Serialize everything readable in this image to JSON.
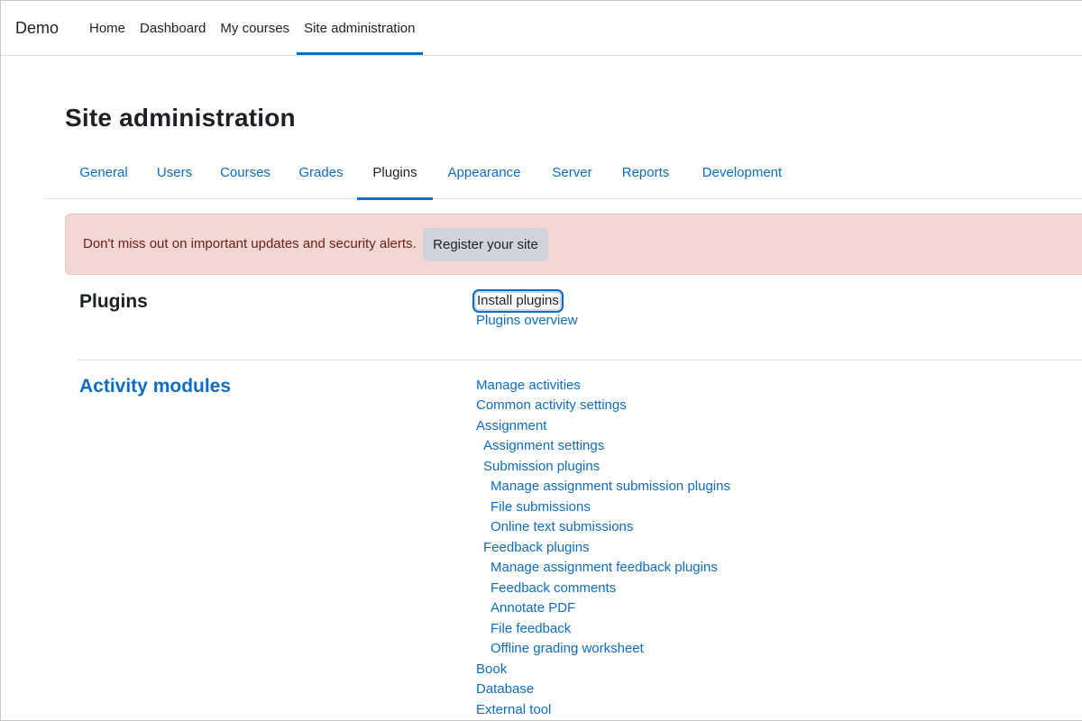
{
  "navbar": {
    "brand": "Demo",
    "items": [
      {
        "label": "Home"
      },
      {
        "label": "Dashboard"
      },
      {
        "label": "My courses"
      },
      {
        "label": "Site administration"
      }
    ]
  },
  "page": {
    "title": "Site administration"
  },
  "tabs": [
    {
      "label": "General"
    },
    {
      "label": "Users"
    },
    {
      "label": "Courses"
    },
    {
      "label": "Grades"
    },
    {
      "label": "Plugins"
    },
    {
      "label": "Appearance"
    },
    {
      "label": "Server"
    },
    {
      "label": "Reports"
    },
    {
      "label": "Development"
    }
  ],
  "alert": {
    "text": "Don't miss out on important updates and security alerts.",
    "button": "Register your site"
  },
  "plugins_section": {
    "title": "Plugins",
    "links": [
      "Install plugins",
      "Plugins overview"
    ]
  },
  "activity_section": {
    "title": "Activity modules",
    "links": [
      {
        "label": "Manage activities"
      },
      {
        "label": "Common activity settings"
      },
      {
        "label": "Assignment"
      },
      {
        "label": "Assignment settings"
      },
      {
        "label": "Submission plugins"
      },
      {
        "label": "Manage assignment submission plugins"
      },
      {
        "label": "File submissions"
      },
      {
        "label": "Online text submissions"
      },
      {
        "label": "Feedback plugins"
      },
      {
        "label": "Manage assignment feedback plugins"
      },
      {
        "label": "Feedback comments"
      },
      {
        "label": "Annotate PDF"
      },
      {
        "label": "File feedback"
      },
      {
        "label": "Offline grading worksheet"
      },
      {
        "label": "Book"
      },
      {
        "label": "Database"
      },
      {
        "label": "External tool"
      }
    ]
  }
}
